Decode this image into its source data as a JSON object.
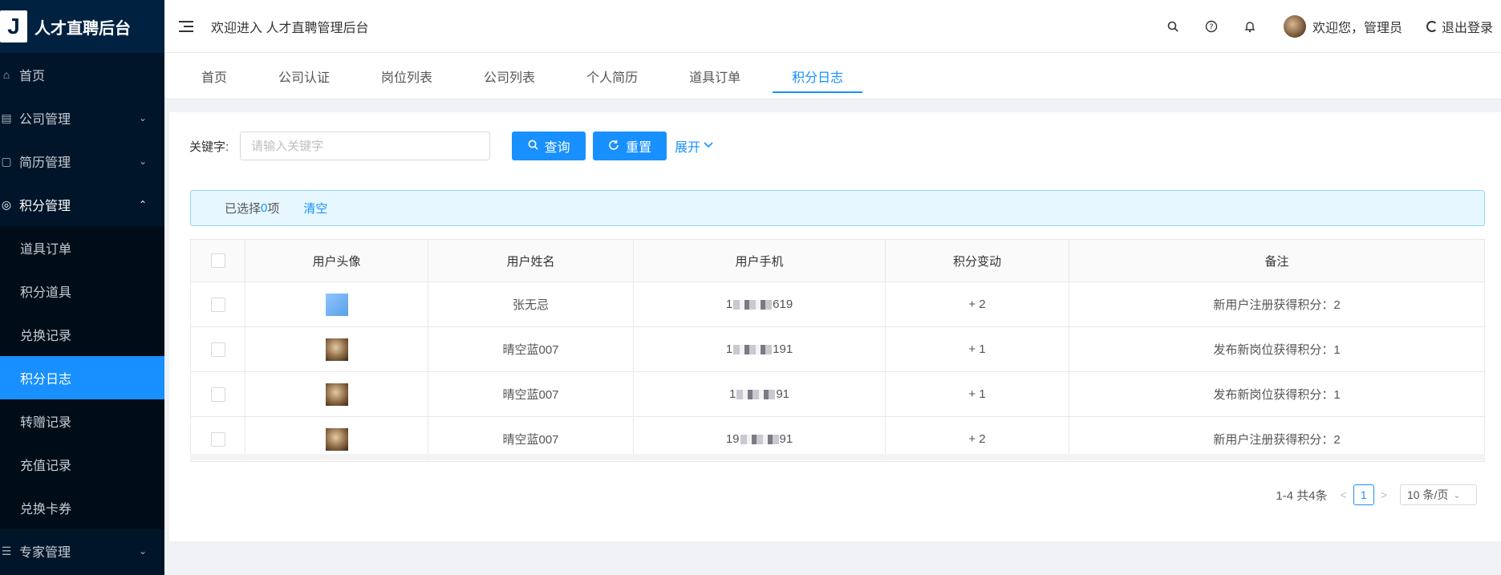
{
  "app": {
    "title": "人才直聘后台",
    "logo_letter": "J"
  },
  "sidebar": {
    "items": [
      {
        "label": "首页",
        "icon": "home-icon"
      },
      {
        "label": "公司管理",
        "icon": "building-icon"
      },
      {
        "label": "简历管理",
        "icon": "resume-icon"
      },
      {
        "label": "积分管理",
        "icon": "points-icon"
      }
    ],
    "sub_items": [
      {
        "label": "道具订单"
      },
      {
        "label": "积分道具"
      },
      {
        "label": "兑换记录"
      },
      {
        "label": "积分日志"
      },
      {
        "label": "转赠记录"
      },
      {
        "label": "充值记录"
      },
      {
        "label": "兑换卡券"
      }
    ],
    "last_item": {
      "label": "专家管理",
      "icon": "list-icon"
    }
  },
  "header": {
    "welcome": "欢迎进入 人才直聘管理后台",
    "user": "欢迎您，管理员",
    "logout": "退出登录"
  },
  "tabs": [
    "首页",
    "公司认证",
    "岗位列表",
    "公司列表",
    "个人简历",
    "道具订单",
    "积分日志"
  ],
  "search": {
    "label": "关键字:",
    "placeholder": "请输入关键字",
    "query": "查询",
    "reset": "重置",
    "expand": "展开"
  },
  "alert": {
    "prefix": "已选择 ",
    "count": "0",
    "suffix": "项",
    "clear": "清空"
  },
  "table": {
    "headers": [
      "用户头像",
      "用户姓名",
      "用户手机",
      "积分变动",
      "备注"
    ],
    "rows": [
      {
        "name": "张无忌",
        "phone_start": "1",
        "phone_end": "619",
        "change": "+ 2",
        "note": "新用户注册获得积分：2"
      },
      {
        "name": "晴空蓝007",
        "phone_start": "1",
        "phone_end": "191",
        "change": "+ 1",
        "note": "发布新岗位获得积分：1"
      },
      {
        "name": "晴空蓝007",
        "phone_start": "1",
        "phone_end": "91",
        "change": "+ 1",
        "note": "发布新岗位获得积分：1"
      },
      {
        "name": "晴空蓝007",
        "phone_start": "19",
        "phone_end": "91",
        "change": "+ 2",
        "note": "新用户注册获得积分：2"
      }
    ]
  },
  "pagination": {
    "summary": "1-4 共4条",
    "current": "1",
    "page_size": "10 条/页"
  },
  "colors": {
    "primary": "#1890ff",
    "sidebar_bg": "#001529"
  }
}
